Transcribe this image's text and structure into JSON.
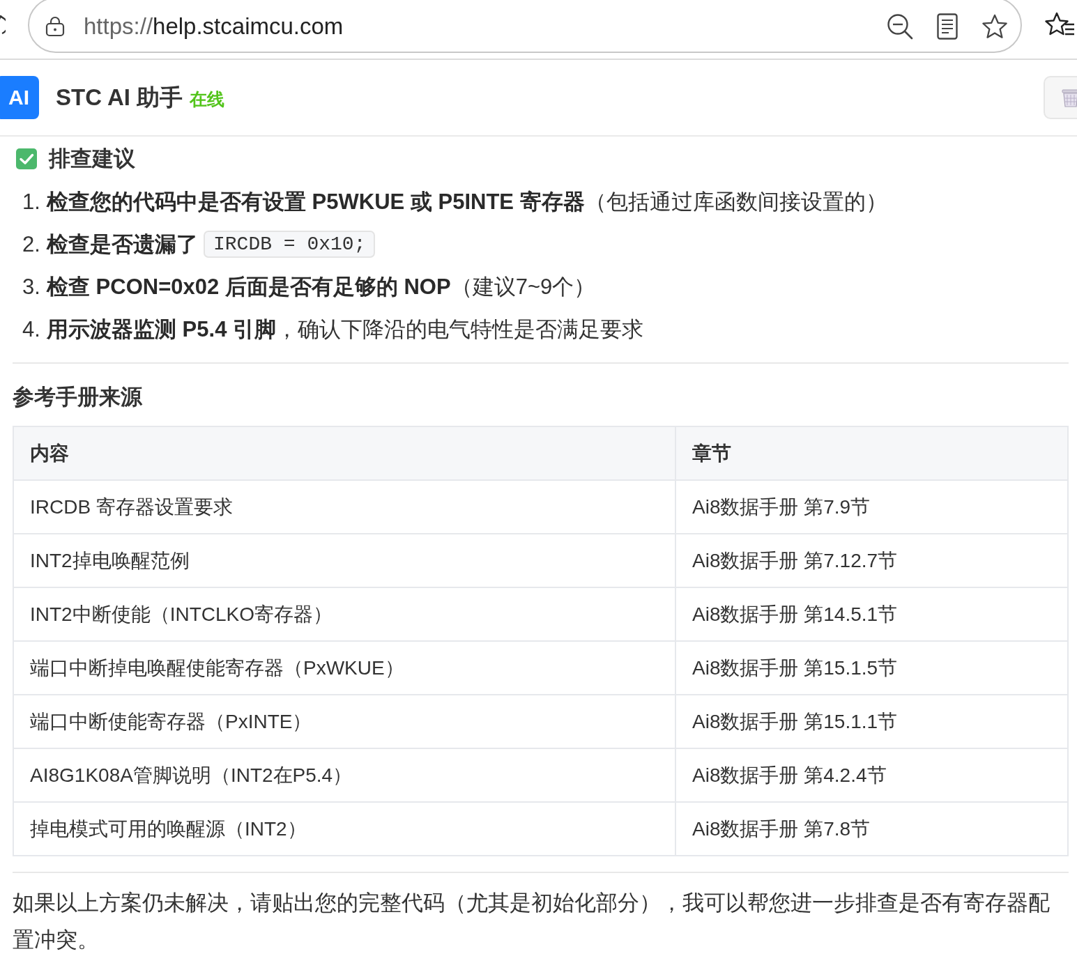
{
  "browser": {
    "url": {
      "scheme": "https://",
      "host": "help.stcaimcu.com"
    }
  },
  "header": {
    "logo": "AI",
    "title": "STC AI 助手",
    "status": "在线"
  },
  "advice": {
    "heading": "排查建议",
    "steps": [
      {
        "number": "1.",
        "text": "**检查您的代码中是否有设置 P5WKUE 或 P5INTE 寄存器**（包括通过库函数间接设置的）"
      },
      {
        "number": "2.",
        "text": "**检查是否遗漏了**",
        "code": "IRCDB = 0x10;"
      },
      {
        "number": "3.",
        "text": "**检查 PCON=0x02 后面是否有足够的 NOP**（建议7~9个）"
      },
      {
        "number": "4.",
        "text": "**用示波器监测 P5.4 引脚**，确认下降沿的电气特性是否满足要求"
      }
    ]
  },
  "sources": {
    "heading": "参考手册来源",
    "table": {
      "columns": [
        "内容",
        "章节"
      ],
      "rows": [
        [
          "IRCDB 寄存器设置要求",
          "Ai8数据手册 第7.9节"
        ],
        [
          "INT2掉电唤醒范例",
          "Ai8数据手册 第7.12.7节"
        ],
        [
          "INT2中断使能（INTCLKO寄存器）",
          "Ai8数据手册 第14.5.1节"
        ],
        [
          "端口中断掉电唤醒使能寄存器（PxWKUE）",
          "Ai8数据手册 第15.1.5节"
        ],
        [
          "端口中断使能寄存器（PxINTE）",
          "Ai8数据手册 第15.1.1节"
        ],
        [
          "AI8G1K08A管脚说明（INT2在P5.4）",
          "Ai8数据手册 第4.2.4节"
        ],
        [
          "掉电模式可用的唤醒源（INT2）",
          "Ai8数据手册 第7.8节"
        ]
      ]
    }
  },
  "closing": "如果以上方案仍未解决，请贴出您的完整代码（尤其是初始化部分），我可以帮您进一步排查是否有寄存器配置冲突。"
}
